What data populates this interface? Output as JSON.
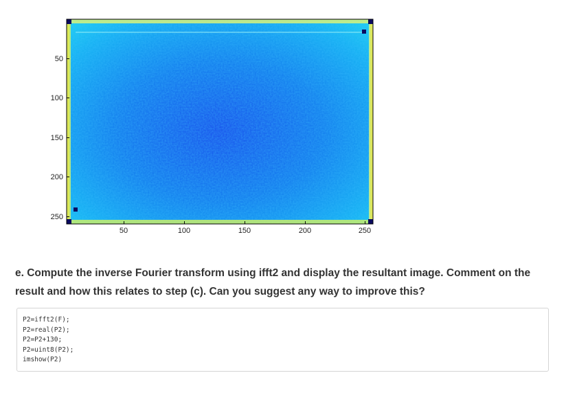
{
  "figure": {
    "x_ticks": [
      "50",
      "100",
      "150",
      "200",
      "250"
    ],
    "y_ticks": [
      "50",
      "100",
      "150",
      "200",
      "250"
    ],
    "colormap": {
      "low": "#1a4ff0",
      "mid": "#19b4f5",
      "high": "#f5f01a",
      "peak": "#0a0a60"
    }
  },
  "question": "e. Compute the inverse Fourier transform using ifft2 and display the resultant image. Comment on the result and how this relates to step (c). Can you suggest any way to improve this?",
  "code_lines": [
    "P2=ifft2(F);",
    "P2=real(P2);",
    "P2=P2+130;",
    "P2=uint8(P2);",
    "imshow(P2)"
  ]
}
